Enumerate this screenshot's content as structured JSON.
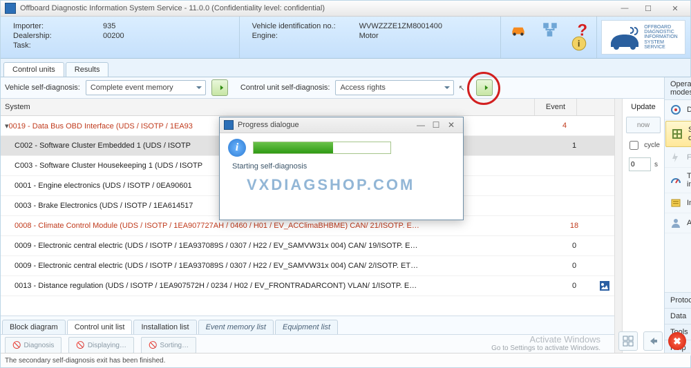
{
  "window": {
    "title": "Offboard Diagnostic Information System Service - 11.0.0  (Confidentiality level: confidential)"
  },
  "header": {
    "importer_label": "Importer:",
    "importer_value": "935",
    "dealership_label": "Dealership:",
    "dealership_value": "00200",
    "task_label": "Task:",
    "task_value": "",
    "vin_label": "Vehicle identification no.:",
    "vin_value": "WVWZZZE1ZM8001400",
    "engine_label": "Engine:",
    "engine_value": "Motor"
  },
  "brand_lines": [
    "OFFBOARD",
    "DIAGNOSTIC",
    "INFORMATION",
    "SYSTEM",
    "SERVICE"
  ],
  "tabs": {
    "control_units": "Control units",
    "results": "Results"
  },
  "filter": {
    "vehicle_label": "Vehicle self-diagnosis:",
    "vehicle_value": "Complete event memory",
    "cu_label": "Control unit self-diagnosis:",
    "cu_value": "Access rights"
  },
  "gridhead": {
    "system": "System",
    "event": "Event",
    "update": "Update",
    "now": "now",
    "cycle": "cycle",
    "cycle_val": "0",
    "cycle_unit": "s"
  },
  "rows": [
    {
      "red": true,
      "root": true,
      "sys": "0019 - Data Bus OBD Interface  (UDS / ISOTP / 1EA93",
      "ev": "4"
    },
    {
      "red": false,
      "sel": true,
      "sys": "C002 - Software Cluster Embedded 1  (UDS / ISOTP",
      "ev": "1"
    },
    {
      "red": false,
      "sys": "C003 - Software Cluster Housekeeping 1  (UDS / ISOTP",
      "ev": ""
    },
    {
      "red": false,
      "sys": "0001 - Engine electronics  (UDS / ISOTP / 0EA90601",
      "ev": ""
    },
    {
      "red": false,
      "sys": "0003 - Brake Electronics  (UDS / ISOTP / 1EA614517",
      "ev": ""
    },
    {
      "red": true,
      "sys": "0008 - Climate Control Module  (UDS / ISOTP / 1EA907727AH / 0460 / H01 / EV_ACClimaBHBME)  CAN/ 21/ISOTP. E…",
      "ev": "18"
    },
    {
      "red": false,
      "sys": "0009 - Electronic central electric  (UDS / ISOTP / 1EA937089S / 0307 / H22 / EV_SAMVW31x 004)  CAN/ 19/ISOTP. E…",
      "ev": "0"
    },
    {
      "red": false,
      "sys": "0009 - Electronic central electric  (UDS / ISOTP / 1EA937089S / 0307 / H22 / EV_SAMVW31x 004)  CAN/ 2/ISOTP. ET…",
      "ev": "0"
    },
    {
      "red": false,
      "sys": "0013 - Distance regulation  (UDS / ISOTP / 1EA907572H / 0234 / H02 / EV_FRONTRADARCONT)  VLAN/ 1/ISOTP. E…",
      "ev": "0",
      "pic": true
    }
  ],
  "bottom_tabs": {
    "block": "Block diagram",
    "culist": "Control unit list",
    "install": "Installation list",
    "evmem": "Event memory list",
    "equip": "Equipment list"
  },
  "actions": {
    "diag": "Diagnosis",
    "disp": "Displaying…",
    "sort": "Sorting…"
  },
  "side": {
    "op_modes": "Operating modes",
    "diagnosis": "Diagnosis",
    "selfdiag": "Self-diagnosis",
    "flashing": "Flashing",
    "test": "Test instruments",
    "info": "Info",
    "admin": "Admin",
    "protocol": "Protocol",
    "data": "Data",
    "tools": "Tools",
    "help": "Help"
  },
  "dialog": {
    "title": "Progress dialogue",
    "msg": "Starting self-diagnosis"
  },
  "status": "The secondary self-diagnosis exit has been finished.",
  "activate": {
    "l1": "Activate Windows",
    "l2": "Go to Settings to activate Windows."
  },
  "watermark": "VXDIAGSHOP.COM"
}
